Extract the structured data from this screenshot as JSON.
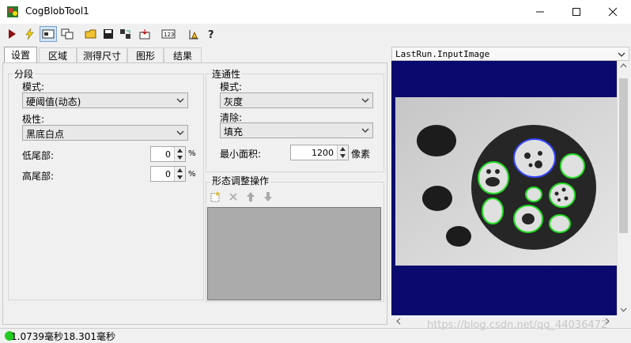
{
  "window": {
    "title": "CogBlobTool1"
  },
  "toolbar": {
    "icons": [
      "run-icon",
      "electric-icon",
      "show-result-icon",
      "display-icon",
      "open-icon",
      "save-icon",
      "reset-icon",
      "load-image-icon",
      "numeric-icon",
      "graphics-icon",
      "help-icon"
    ]
  },
  "tabs": [
    "设置",
    "区域",
    "测得尺寸",
    "图形",
    "结果"
  ],
  "segmentation": {
    "title": "分段",
    "mode_label": "模式:",
    "mode_value": "硬阈值(动态)",
    "polarity_label": "极性:",
    "polarity_value": "黑底白点",
    "low_tail_label": "低尾部:",
    "low_tail_value": "0",
    "high_tail_label": "高尾部:",
    "high_tail_value": "0",
    "percent": "%"
  },
  "connectivity": {
    "title": "连通性",
    "mode_label": "模式:",
    "mode_value": "灰度",
    "cleanup_label": "清除:",
    "cleanup_value": "填充",
    "min_area_label": "最小面积:",
    "min_area_value": "1200",
    "unit": "像素"
  },
  "morphology": {
    "title": "形态调整操作"
  },
  "image_view": {
    "header": "LastRun.InputImage"
  },
  "status": {
    "text": "1.0739毫秒18.301毫秒",
    "indicator_color": "#22cc22"
  },
  "watermark": "https://blog.csdn.net/qq_44036472",
  "colors": {
    "image_bg": "#0a0a6e",
    "blob_outline": "#22dd22",
    "selected_blob_outline": "#3344ff"
  }
}
